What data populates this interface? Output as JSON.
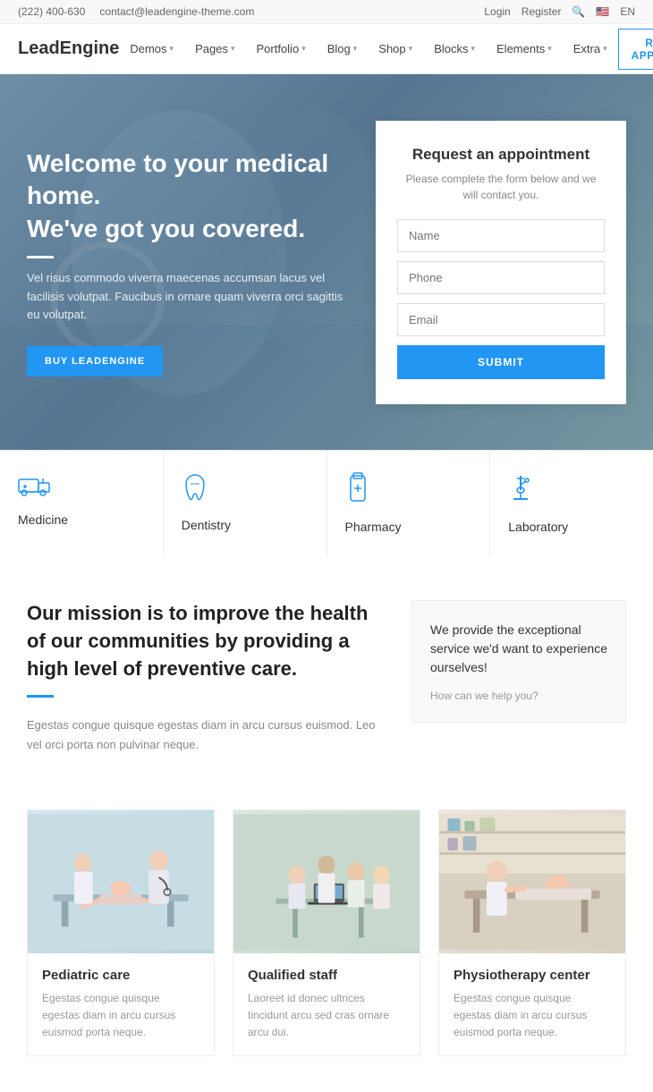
{
  "topbar": {
    "phone": "(222) 400-630",
    "email": "contact@leadengine-theme.com",
    "login": "Login",
    "register": "Register",
    "lang": "EN"
  },
  "header": {
    "logo": "LeadEngine",
    "nav": [
      {
        "label": "Demos",
        "hasDropdown": true
      },
      {
        "label": "Pages",
        "hasDropdown": true
      },
      {
        "label": "Portfolio",
        "hasDropdown": true
      },
      {
        "label": "Blog",
        "hasDropdown": true
      },
      {
        "label": "Shop",
        "hasDropdown": true
      },
      {
        "label": "Blocks",
        "hasDropdown": true
      },
      {
        "label": "Elements",
        "hasDropdown": true
      },
      {
        "label": "Extra",
        "hasDropdown": true
      }
    ],
    "cta": "REQUEST APPOINTMENT"
  },
  "hero": {
    "title": "Welcome to your medical home.\nWe've got you covered.",
    "text": "Vel risus commodo viverra maecenas accumsan lacus vel facilisis volutpat. Faucibus in ornare quam viverra orci sagittis eu volutpat.",
    "cta": "BUY LEADENGINE"
  },
  "appointment": {
    "title": "Request an appointment",
    "subtitle": "Please complete the form below and we will contact you.",
    "name_placeholder": "Name",
    "phone_placeholder": "Phone",
    "email_placeholder": "Email",
    "submit": "SUBMIT"
  },
  "services": [
    {
      "label": "Medicine",
      "icon": "ambulance"
    },
    {
      "label": "Dentistry",
      "icon": "tooth"
    },
    {
      "label": "Pharmacy",
      "icon": "pharmacy"
    },
    {
      "label": "Laboratory",
      "icon": "microscope"
    }
  ],
  "mission": {
    "title": "Our mission is to improve the health of our communities by providing a high level of preventive care.",
    "text": "Egestas congue quisque egestas diam in arcu cursus euismod. Leo vel orci porta non pulvinar neque.",
    "right_title": "We provide the exceptional service we'd want to experience ourselves!",
    "right_link": "How can we help you?"
  },
  "cards": [
    {
      "title": "Pediatric care",
      "text": "Egestas congue quisque egestas diam in arcu cursus euismod porta neque."
    },
    {
      "title": "Qualified staff",
      "text": "Laoreet id donec ultrices tincidunt arcu sed cras ornare arcu dui."
    },
    {
      "title": "Physiotherapy center",
      "text": "Egestas congue quisque egestas diam in arcu cursus euismod porta neque."
    }
  ]
}
